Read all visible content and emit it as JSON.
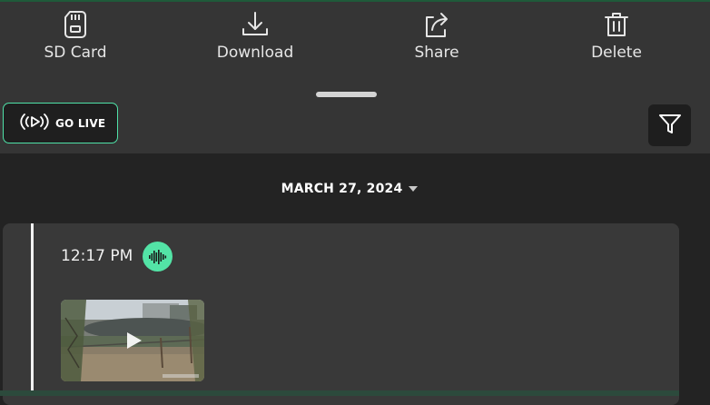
{
  "actions": {
    "sd_card": {
      "label": "SD Card",
      "icon": "sd-card-icon"
    },
    "download": {
      "label": "Download",
      "icon": "download-icon"
    },
    "share": {
      "label": "Share",
      "icon": "share-icon"
    },
    "delete": {
      "label": "Delete",
      "icon": "trash-icon"
    }
  },
  "live": {
    "label": "GO LIVE",
    "icon": "broadcast-play-icon"
  },
  "filter": {
    "icon": "filter-icon"
  },
  "date_selector": {
    "label": "MARCH 27, 2024",
    "icon": "caret-down-icon"
  },
  "event": {
    "time": "12:17 PM",
    "badge_icon": "audio-waveform-icon",
    "thumbnail_icon": "play-icon"
  },
  "colors": {
    "accent": "#4fe2a8",
    "sheet_background": "#353535",
    "page_background": "#232323",
    "card_background": "#393939"
  }
}
